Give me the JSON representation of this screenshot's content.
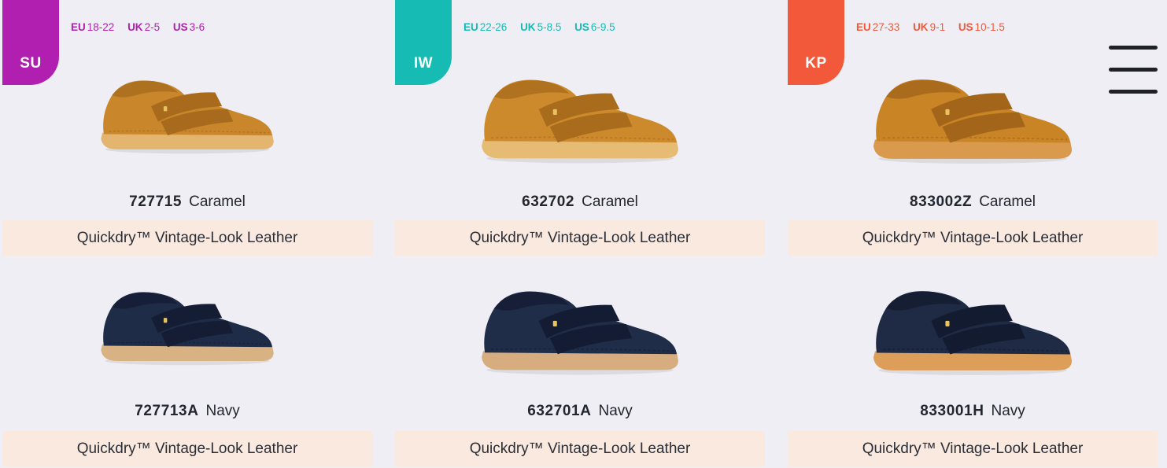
{
  "columns": [
    {
      "tab": "SU",
      "color": "#b11fb0",
      "sizes": [
        {
          "label": "EU",
          "value": "18-22"
        },
        {
          "label": "UK",
          "value": "2-5"
        },
        {
          "label": "US",
          "value": "3-6"
        }
      ],
      "products": [
        {
          "code": "727715",
          "colour": "Caramel",
          "material": "Quickdry™ Vintage-Look Leather",
          "shoe_upper": "#c9862a",
          "shoe_dark": "#a86b1d",
          "shoe_sole": "#e3b56f"
        },
        {
          "code": "727713A",
          "colour": "Navy",
          "material": "Quickdry™ Vintage-Look Leather",
          "shoe_upper": "#1f2c48",
          "shoe_dark": "#141d33",
          "shoe_sole": "#d8b283"
        }
      ]
    },
    {
      "tab": "IW",
      "color": "#16bcb3",
      "sizes": [
        {
          "label": "EU",
          "value": "22-26"
        },
        {
          "label": "UK",
          "value": "5-8.5"
        },
        {
          "label": "US",
          "value": "6-9.5"
        }
      ],
      "products": [
        {
          "code": "632702",
          "colour": "Caramel",
          "material": "Quickdry™ Vintage-Look Leather",
          "shoe_upper": "#cc8a2c",
          "shoe_dark": "#a96c1c",
          "shoe_sole": "#e6bb74"
        },
        {
          "code": "632701A",
          "colour": "Navy",
          "material": "Quickdry™ Vintage-Look Leather",
          "shoe_upper": "#202d48",
          "shoe_dark": "#141c33",
          "shoe_sole": "#d7ad80"
        }
      ]
    },
    {
      "tab": "KP",
      "color": "#f2593a",
      "sizes": [
        {
          "label": "EU",
          "value": "27-33"
        },
        {
          "label": "UK",
          "value": "9-1"
        },
        {
          "label": "US",
          "value": "10-1.5"
        }
      ],
      "products": [
        {
          "code": "833002Z",
          "colour": "Caramel",
          "material": "Quickdry™ Vintage-Look Leather",
          "shoe_upper": "#c98426",
          "shoe_dark": "#a3651a",
          "shoe_sole": "#d99a4e"
        },
        {
          "code": "833001H",
          "colour": "Navy",
          "material": "Quickdry™ Vintage-Look Leather",
          "shoe_upper": "#1f2b44",
          "shoe_dark": "#131b30",
          "shoe_sole": "#dd9e5a"
        }
      ]
    }
  ],
  "menu": {
    "icon": "hamburger-menu-icon"
  }
}
